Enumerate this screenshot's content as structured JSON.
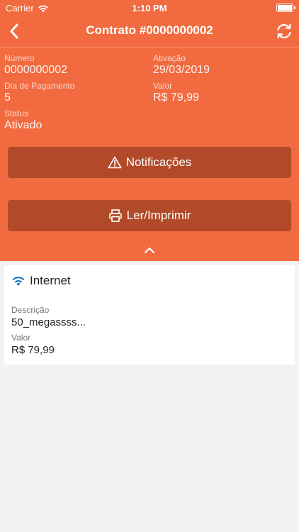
{
  "status_bar": {
    "carrier": "Carrier",
    "time": "1:10 PM"
  },
  "nav": {
    "title": "Contrato #0000000002",
    "back_icon": "chevron-left-icon",
    "refresh_icon": "refresh-icon"
  },
  "contract": {
    "numero_label": "Número",
    "numero_value": "0000000002",
    "ativacao_label": "Ativação",
    "ativacao_value": "29/03/2019",
    "dia_label": "Dia de Pagamento",
    "dia_value": "5",
    "valor_label": "Valor",
    "valor_value": "R$ 79,99",
    "status_label": "Status",
    "status_value": "Ativado"
  },
  "buttons": {
    "notificacoes": "Notificações",
    "ler_imprimir": "Ler/Imprimir"
  },
  "service": {
    "name": "Internet",
    "descricao_label": "Descrição",
    "descricao_value": "50_megassss...",
    "valor_label": "Valor",
    "valor_value": "R$ 79,99"
  },
  "colors": {
    "header_bg": "#f26a3f",
    "button_bg": "#b24a2a",
    "wifi_icon": "#1a73b8",
    "page_bg": "#f2f2f2"
  }
}
